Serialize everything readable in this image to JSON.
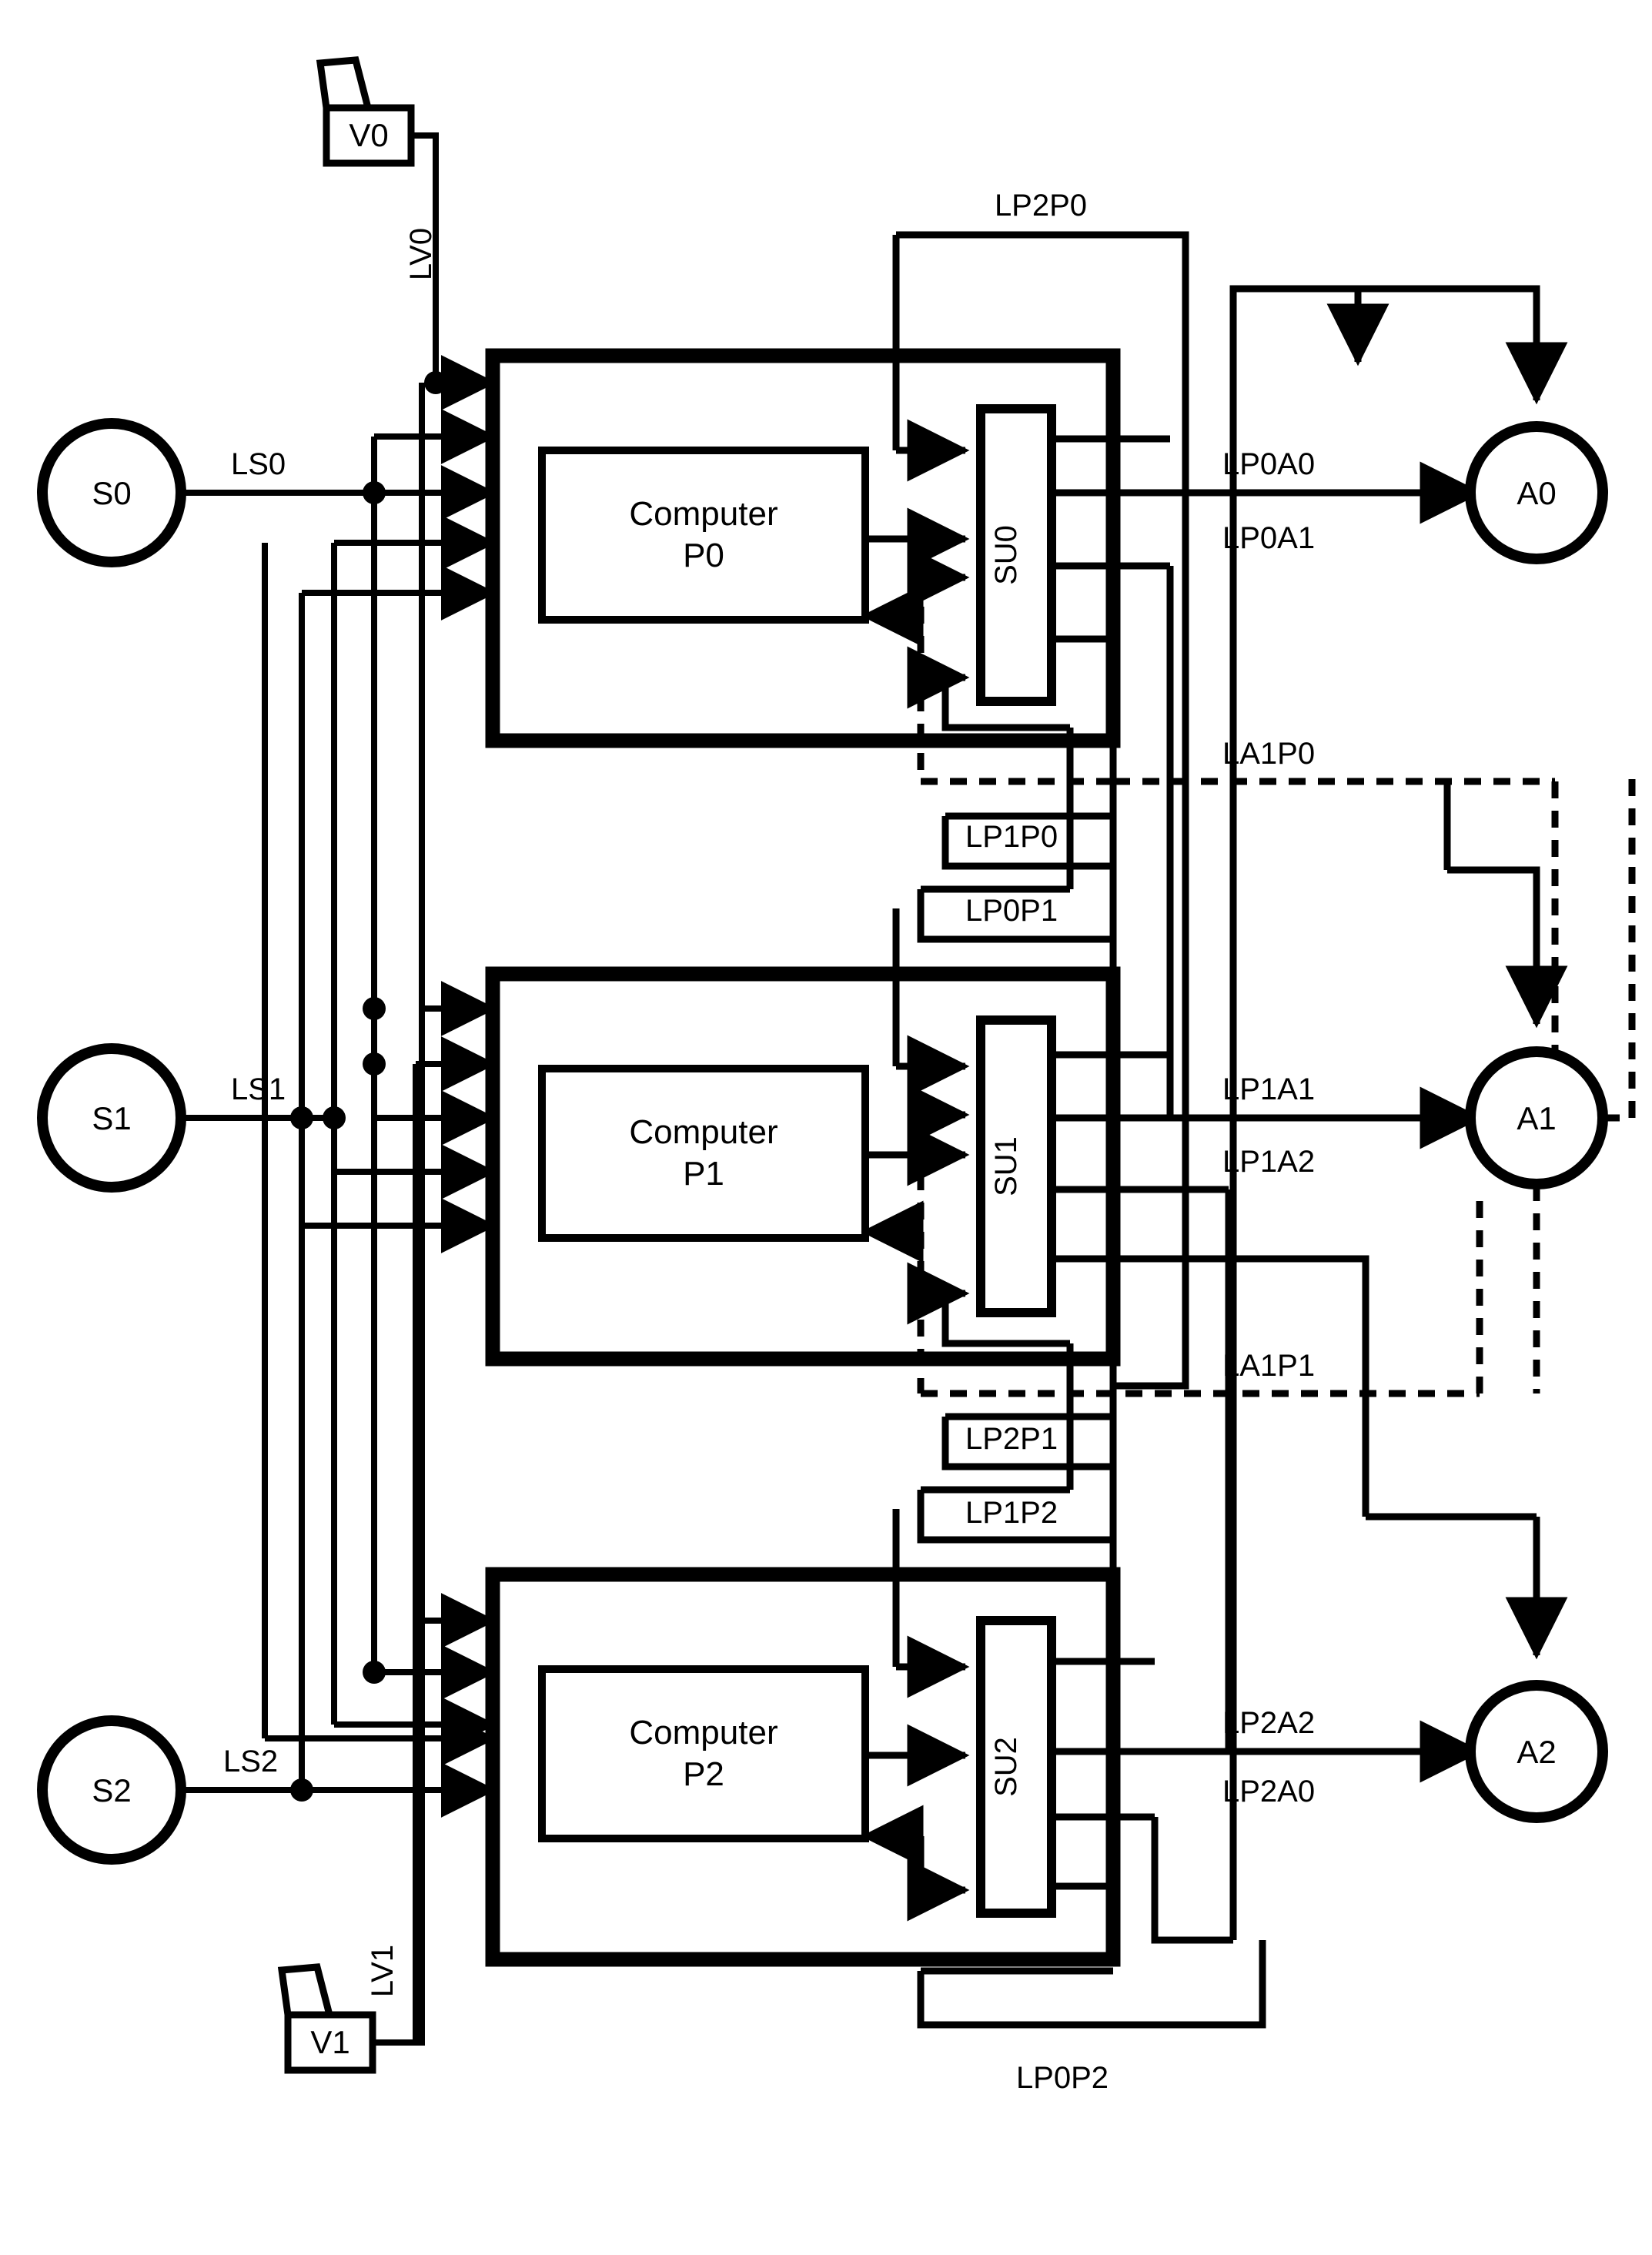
{
  "diagram": {
    "title": "Distributed computer / sensor / actuator interconnection block diagram",
    "stroke_color": "#000000",
    "background_color": "#ffffff"
  },
  "sensors": [
    {
      "id": "S0",
      "label": "S0",
      "link_label": "LS0"
    },
    {
      "id": "S1",
      "label": "S1",
      "link_label": "LS1"
    },
    {
      "id": "S2",
      "label": "S2",
      "link_label": "LS2"
    }
  ],
  "actuators": [
    {
      "id": "A0",
      "label": "A0"
    },
    {
      "id": "A1",
      "label": "A1"
    },
    {
      "id": "A2",
      "label": "A2"
    }
  ],
  "valves": [
    {
      "id": "V0",
      "label": "V0",
      "link_label": "LV0"
    },
    {
      "id": "V1",
      "label": "V1",
      "link_label": "LV1"
    }
  ],
  "computers": [
    {
      "id": "P0",
      "line1": "Computer",
      "line2": "P0",
      "switch_label": "SU0"
    },
    {
      "id": "P1",
      "line1": "Computer",
      "line2": "P1",
      "switch_label": "SU1"
    },
    {
      "id": "P2",
      "line1": "Computer",
      "line2": "P2",
      "switch_label": "SU2"
    }
  ],
  "link_labels": {
    "lp2p0": "LP2P0",
    "lp0a0": "LP0A0",
    "lp0a1": "LP0A1",
    "la1p0": "LA1P0",
    "lp1p0": "LP1P0",
    "lp0p1": "LP0P1",
    "lp1a1": "LP1A1",
    "lp1a2": "LP1A2",
    "la1p1": "LA1P1",
    "lp2p1": "LP2P1",
    "lp1p2": "LP1P2",
    "lp2a2": "LP2A2",
    "lp2a0": "LP2A0",
    "lp0p2": "LP0P2",
    "lv0": "LV0",
    "lv1": "LV1",
    "ls0": "LS0",
    "ls1": "LS1",
    "ls2": "LS2"
  }
}
